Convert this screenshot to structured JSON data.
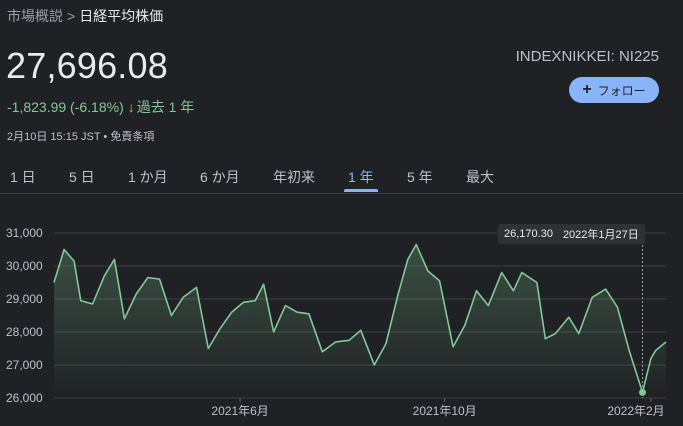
{
  "breadcrumb": {
    "parent": "市場概説",
    "separator": ">",
    "current": "日経平均株価"
  },
  "quote": {
    "price": "27,696.08",
    "change": "-1,823.99 (-6.18%)",
    "period": "過去 1 年",
    "timestamp": "2月10日 15:15 JST • 免責条項",
    "ticker": "INDEXNIKKEI: NI225"
  },
  "follow_button": {
    "label": "フォロー"
  },
  "tabs": [
    {
      "label": "1 日"
    },
    {
      "label": "5 日"
    },
    {
      "label": "1 か月"
    },
    {
      "label": "6 か月"
    },
    {
      "label": "年初来"
    },
    {
      "label": "1 年"
    },
    {
      "label": "5 年"
    },
    {
      "label": "最大"
    }
  ],
  "active_tab": "1 年",
  "tooltip": {
    "value": "26,170.30",
    "date": "2022年1月27日"
  },
  "colors": {
    "accent": "#8ab4f8",
    "line": "#81c995",
    "text": "#e8eaed",
    "muted": "#bdc1c6",
    "grid": "#3c4043"
  },
  "chart_data": {
    "type": "area",
    "ylim": [
      26000,
      31000
    ],
    "y_ticks": [
      "31,000",
      "30,000",
      "29,000",
      "28,000",
      "27,000",
      "26,000"
    ],
    "y_tick_values": [
      31000,
      30000,
      29000,
      28000,
      27000,
      26000
    ],
    "x_ticks": [
      "2021年6月",
      "2021年10月",
      "2022年2月"
    ],
    "x_tick_dates": [
      "2021-06-01",
      "2021-10-01",
      "2022-02-01"
    ],
    "x_range": [
      "2021-02-10",
      "2022-02-10"
    ],
    "series": [
      {
        "points": [
          [
            "2021-02-10",
            29500
          ],
          [
            "2021-02-16",
            30500
          ],
          [
            "2021-02-22",
            30150
          ],
          [
            "2021-02-26",
            28950
          ],
          [
            "2021-03-05",
            28850
          ],
          [
            "2021-03-12",
            29700
          ],
          [
            "2021-03-18",
            30200
          ],
          [
            "2021-03-24",
            28400
          ],
          [
            "2021-03-31",
            29150
          ],
          [
            "2021-04-07",
            29650
          ],
          [
            "2021-04-14",
            29600
          ],
          [
            "2021-04-21",
            28500
          ],
          [
            "2021-04-28",
            29050
          ],
          [
            "2021-05-06",
            29350
          ],
          [
            "2021-05-13",
            27500
          ],
          [
            "2021-05-20",
            28100
          ],
          [
            "2021-05-27",
            28600
          ],
          [
            "2021-06-03",
            28900
          ],
          [
            "2021-06-10",
            28950
          ],
          [
            "2021-06-15",
            29450
          ],
          [
            "2021-06-21",
            28000
          ],
          [
            "2021-06-28",
            28800
          ],
          [
            "2021-07-05",
            28600
          ],
          [
            "2021-07-12",
            28550
          ],
          [
            "2021-07-20",
            27400
          ],
          [
            "2021-07-28",
            27700
          ],
          [
            "2021-08-05",
            27750
          ],
          [
            "2021-08-12",
            28050
          ],
          [
            "2021-08-20",
            27000
          ],
          [
            "2021-08-27",
            27650
          ],
          [
            "2021-09-03",
            29100
          ],
          [
            "2021-09-09",
            30200
          ],
          [
            "2021-09-14",
            30650
          ],
          [
            "2021-09-21",
            29850
          ],
          [
            "2021-09-28",
            29550
          ],
          [
            "2021-10-06",
            27550
          ],
          [
            "2021-10-13",
            28200
          ],
          [
            "2021-10-20",
            29250
          ],
          [
            "2021-10-27",
            28800
          ],
          [
            "2021-11-04",
            29800
          ],
          [
            "2021-11-11",
            29250
          ],
          [
            "2021-11-16",
            29800
          ],
          [
            "2021-11-25",
            29500
          ],
          [
            "2021-11-30",
            27800
          ],
          [
            "2021-12-06",
            27950
          ],
          [
            "2021-12-14",
            28450
          ],
          [
            "2021-12-20",
            27950
          ],
          [
            "2021-12-28",
            29050
          ],
          [
            "2022-01-05",
            29300
          ],
          [
            "2022-01-12",
            28750
          ],
          [
            "2022-01-19",
            27450
          ],
          [
            "2022-01-27",
            26170
          ],
          [
            "2022-02-01",
            27200
          ],
          [
            "2022-02-04",
            27450
          ],
          [
            "2022-02-10",
            27696
          ]
        ]
      }
    ],
    "highlight": {
      "date": "2022-01-27",
      "value": 26170
    }
  }
}
